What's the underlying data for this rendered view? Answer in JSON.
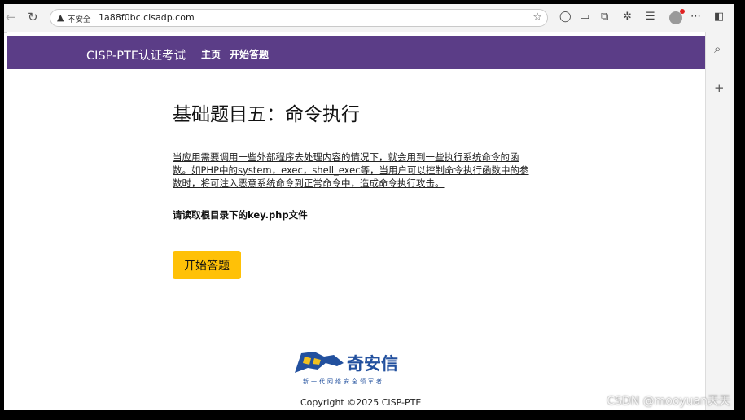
{
  "browser": {
    "security_label": "不安全",
    "url": "1a88f0bc.clsadp.com"
  },
  "nav": {
    "brand": "CISP-PTE认证考试",
    "links": [
      "主页",
      "开始答题"
    ]
  },
  "content": {
    "title": "基础题目五：命令执行",
    "description": "当应用需要调用一些外部程序去处理内容的情况下，就会用到一些执行系统命令的函数。如PHP中的system，exec，shell_exec等，当用户可以控制命令执行函数中的参数时，将可注入恶意系统命令到正常命令中，造成命令执行攻击。",
    "task": "请读取根目录下的key.php文件",
    "start_button": "开始答题"
  },
  "footer": {
    "logo_name": "奇安信",
    "logo_slogan": "新一代网络安全领军者",
    "copyright": "Copyright ©2025 CISP-PTE"
  },
  "watermark": "CSDN @mooyuan天天",
  "colors": {
    "nav_bg": "#5b3d87",
    "button_bg": "#ffc107",
    "logo_blue": "#22509e"
  },
  "icons": [
    "back-icon",
    "refresh-icon",
    "warning-icon",
    "star-icon",
    "tab-icon",
    "reader-icon",
    "collections-icon",
    "extensions-icon",
    "favorites-icon",
    "avatar",
    "more-icon",
    "sidebar-toggle-icon",
    "search-icon",
    "plus-icon"
  ]
}
